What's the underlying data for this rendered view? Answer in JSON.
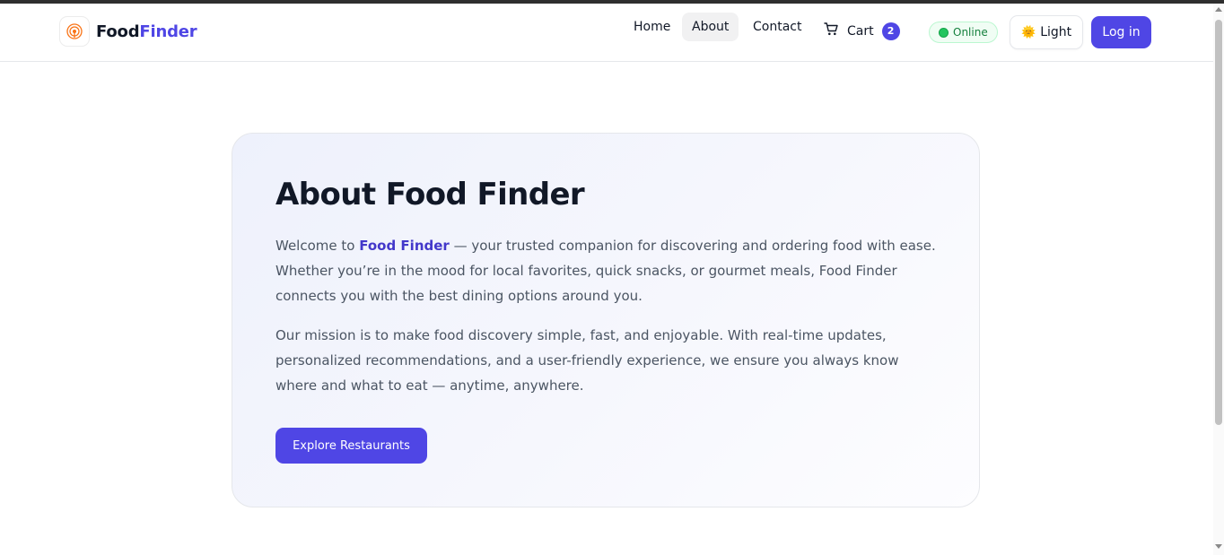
{
  "brand": {
    "name_part1": "Food",
    "name_part2": "Finder",
    "logo_icon": "target-icon",
    "accent_color": "#4f46e5"
  },
  "nav": {
    "links": [
      {
        "label": "Home",
        "active": false
      },
      {
        "label": "About",
        "active": true
      },
      {
        "label": "Contact",
        "active": false
      }
    ]
  },
  "cart": {
    "icon": "cart-icon",
    "label": "Cart",
    "count": "2"
  },
  "status": {
    "label": "Online",
    "icon": "green-dot-icon",
    "color": "#22c55e"
  },
  "theme": {
    "icon": "sun-icon",
    "label": "Light"
  },
  "login": {
    "label": "Log in"
  },
  "about": {
    "title": "About Food Finder",
    "p1_prefix": "Welcome to ",
    "p1_highlight": "Food Finder",
    "p1_rest": " — your trusted companion for discovering and ordering food with ease. Whether you’re in the mood for local favorites, quick snacks, or gourmet meals, Food Finder connects you with the best dining options around you.",
    "p2": "Our mission is to make food discovery simple, fast, and enjoyable. With real-time updates, personalized recommendations, and a user-friendly experience, we ensure you always know where and what to eat — anytime, anywhere.",
    "cta_label": "Explore Restaurants"
  }
}
